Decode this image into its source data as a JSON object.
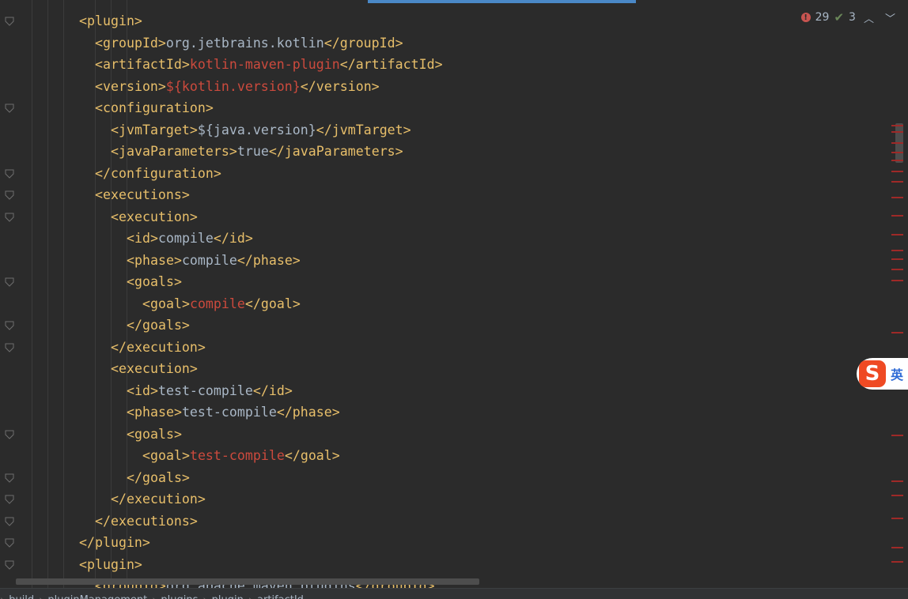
{
  "inspection": {
    "errors": "29",
    "warnings": "3",
    "error_icon": "exclamation-circle-icon",
    "warning_icon": "double-check-icon",
    "prev_icon": "chevron-up-icon",
    "next_icon": "chevron-down-icon"
  },
  "ime": {
    "logo": "S",
    "lang": "英"
  },
  "breadcrumb": {
    "items": [
      "build",
      "pluginManagement",
      "plugins",
      "plugin",
      "artifactId"
    ]
  },
  "colors": {
    "background": "#2b2b2b",
    "tag": "#e8bf6a",
    "text": "#a9b7c6",
    "unresolved": "#cc4a3d",
    "error_mark": "#9e2927",
    "active_tab_indicator": "#4a88c7"
  },
  "code": {
    "lines": [
      {
        "indent": 4,
        "segments": [
          {
            "t": "tag",
            "v": "<plugin>"
          }
        ]
      },
      {
        "indent": 5,
        "segments": [
          {
            "t": "tag",
            "v": "<groupId>"
          },
          {
            "t": "txt",
            "v": "org.jetbrains.kotlin"
          },
          {
            "t": "tag",
            "v": "</groupId>"
          }
        ]
      },
      {
        "indent": 5,
        "segments": [
          {
            "t": "tag",
            "v": "<artifactId>"
          },
          {
            "t": "red",
            "v": "kotlin-maven-plugin"
          },
          {
            "t": "tag",
            "v": "</artifactId>"
          }
        ]
      },
      {
        "indent": 5,
        "segments": [
          {
            "t": "tag",
            "v": "<version>"
          },
          {
            "t": "red",
            "v": "${kotlin.version}"
          },
          {
            "t": "tag",
            "v": "</version>"
          }
        ]
      },
      {
        "indent": 5,
        "segments": [
          {
            "t": "tag",
            "v": "<configuration>"
          }
        ]
      },
      {
        "indent": 6,
        "segments": [
          {
            "t": "tag",
            "v": "<jvmTarget>"
          },
          {
            "t": "txt",
            "v": "${java.version}"
          },
          {
            "t": "tag",
            "v": "</jvmTarget>"
          }
        ]
      },
      {
        "indent": 6,
        "segments": [
          {
            "t": "tag",
            "v": "<javaParameters>"
          },
          {
            "t": "txt",
            "v": "true"
          },
          {
            "t": "tag",
            "v": "</javaParameters>"
          }
        ]
      },
      {
        "indent": 5,
        "segments": [
          {
            "t": "tag",
            "v": "</configuration>"
          }
        ]
      },
      {
        "indent": 5,
        "segments": [
          {
            "t": "tag",
            "v": "<executions>"
          }
        ]
      },
      {
        "indent": 6,
        "segments": [
          {
            "t": "tag",
            "v": "<execution>"
          }
        ]
      },
      {
        "indent": 7,
        "segments": [
          {
            "t": "tag",
            "v": "<id>"
          },
          {
            "t": "txt",
            "v": "compile"
          },
          {
            "t": "tag",
            "v": "</id>"
          }
        ]
      },
      {
        "indent": 7,
        "segments": [
          {
            "t": "tag",
            "v": "<phase>"
          },
          {
            "t": "txt",
            "v": "compile"
          },
          {
            "t": "tag",
            "v": "</phase>"
          }
        ]
      },
      {
        "indent": 7,
        "segments": [
          {
            "t": "tag",
            "v": "<goals>"
          }
        ]
      },
      {
        "indent": 8,
        "segments": [
          {
            "t": "tag",
            "v": "<goal>"
          },
          {
            "t": "red",
            "v": "compile"
          },
          {
            "t": "tag",
            "v": "</goal>"
          }
        ]
      },
      {
        "indent": 7,
        "segments": [
          {
            "t": "tag",
            "v": "</goals>"
          }
        ]
      },
      {
        "indent": 6,
        "segments": [
          {
            "t": "tag",
            "v": "</execution>"
          }
        ]
      },
      {
        "indent": 6,
        "segments": [
          {
            "t": "tag",
            "v": "<execution>"
          }
        ]
      },
      {
        "indent": 7,
        "segments": [
          {
            "t": "tag",
            "v": "<id>"
          },
          {
            "t": "txt",
            "v": "test-compile"
          },
          {
            "t": "tag",
            "v": "</id>"
          }
        ]
      },
      {
        "indent": 7,
        "segments": [
          {
            "t": "tag",
            "v": "<phase>"
          },
          {
            "t": "txt",
            "v": "test-compile"
          },
          {
            "t": "tag",
            "v": "</phase>"
          }
        ]
      },
      {
        "indent": 7,
        "segments": [
          {
            "t": "tag",
            "v": "<goals>"
          }
        ]
      },
      {
        "indent": 8,
        "segments": [
          {
            "t": "tag",
            "v": "<goal>"
          },
          {
            "t": "red",
            "v": "test-compile"
          },
          {
            "t": "tag",
            "v": "</goal>"
          }
        ]
      },
      {
        "indent": 7,
        "segments": [
          {
            "t": "tag",
            "v": "</goals>"
          }
        ]
      },
      {
        "indent": 6,
        "segments": [
          {
            "t": "tag",
            "v": "</execution>"
          }
        ]
      },
      {
        "indent": 5,
        "segments": [
          {
            "t": "tag",
            "v": "</executions>"
          }
        ]
      },
      {
        "indent": 4,
        "segments": [
          {
            "t": "tag",
            "v": "</plugin>"
          }
        ]
      },
      {
        "indent": 4,
        "segments": [
          {
            "t": "tag",
            "v": "<plugin>"
          }
        ]
      },
      {
        "indent": 5,
        "segments": [
          {
            "t": "tag",
            "v": "<groupId>"
          },
          {
            "t": "txt",
            "v": "org.apache.maven.plugins"
          },
          {
            "t": "tag",
            "v": "</groupId>"
          }
        ]
      }
    ]
  }
}
